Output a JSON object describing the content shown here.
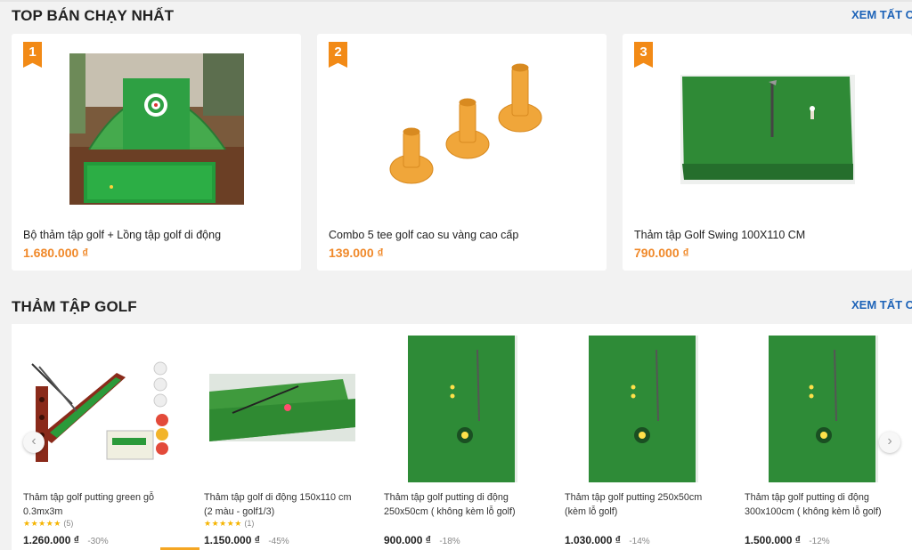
{
  "top_section": {
    "title": "TOP BÁN CHẠY NHẤT",
    "see_all": "XEM TẤT CẢ",
    "items": [
      {
        "rank": "1",
        "name": "Bộ thảm tập golf + Lồng tập golf di động",
        "price": "1.680.000 ₫"
      },
      {
        "rank": "2",
        "name": "Combo 5 tee golf cao su vàng cao cấp",
        "price": "139.000 ₫"
      },
      {
        "rank": "3",
        "name": "Thảm tập Golf Swing 100X110 CM",
        "price": "790.000 ₫"
      }
    ]
  },
  "mat_section": {
    "title": "THẢM TẬP GOLF",
    "see_all": "XEM TẤT CẢ",
    "items": [
      {
        "name": "Thảm tập golf putting green gỗ 0.3mx3m",
        "stars": "★★★★★",
        "reviews": "(5)",
        "price": "1.260.000 ₫",
        "discount": "-30%"
      },
      {
        "name": "Thảm tập golf di động 150x110 cm (2 màu - golf1/3)",
        "stars": "★★★★★",
        "reviews": "(1)",
        "price": "1.150.000 ₫",
        "discount": "-45%"
      },
      {
        "name": "Thảm tập golf putting di động 250x50cm ( không kèm lỗ golf)",
        "price": "900.000 ₫",
        "discount": "-18%"
      },
      {
        "name": "Thảm tập golf putting 250x50cm (kèm lỗ golf)",
        "price": "1.030.000 ₫",
        "discount": "-14%"
      },
      {
        "name": "Thảm tập golf putting di động 300x100cm ( không kèm lỗ golf)",
        "price": "1.500.000 ₫",
        "discount": "-12%"
      }
    ],
    "prev_arrow": "‹",
    "next_arrow": "›"
  },
  "colors": {
    "accent": "#f0892a",
    "link": "#1d63b8",
    "turf": "#2f8f3a"
  }
}
